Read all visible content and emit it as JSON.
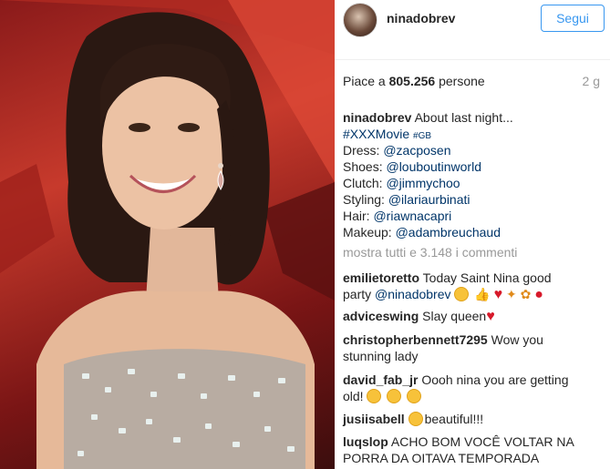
{
  "post": {
    "username": "ninadobrev",
    "follow_label": "Segui",
    "likes_prefix": "Piace a",
    "likes_count": "805.256",
    "likes_suffix": "persone",
    "time": "2 g",
    "caption": {
      "author": "ninadobrev",
      "text": "About last night...",
      "hashtag": "#XXXMovie",
      "hashtag2": "#GB",
      "lines": [
        {
          "label": "Dress:",
          "handle": "@zacposen"
        },
        {
          "label": "Shoes:",
          "handle": "@louboutinworld"
        },
        {
          "label": "Clutch:",
          "handle": "@jimmychoo"
        },
        {
          "label": "Styling:",
          "handle": "@ilariaurbinati"
        },
        {
          "label": "Hair:",
          "handle": "@riawnacapri"
        },
        {
          "label": "Makeup:",
          "handle": "@adambreuchaud"
        }
      ]
    },
    "view_all": "mostra tutti e 3.148 i commenti"
  },
  "comments": [
    {
      "user": "emilietoretto",
      "text1": "Today Saint Nina good",
      "text2_pre": "party ",
      "text2_mention": "@ninadobrev"
    },
    {
      "user": "adviceswing",
      "text1": "Slay queen"
    },
    {
      "user": "christopherbennett7295",
      "text1": "Wow you",
      "text2": "stunning lady"
    },
    {
      "user": "david_fab_jr",
      "text1": "Oooh nina you are getting",
      "text2": "old!"
    },
    {
      "user": "jusiisabell",
      "text1": "beautiful!!!"
    },
    {
      "user": "luqslop",
      "text1": "ACHO BOM VOCÊ VOLTAR NA",
      "text2": "PORRA DA OITAVA TEMPORADA"
    }
  ],
  "icons": {
    "avatar": "profile-avatar",
    "heart": "heart-emoji",
    "face": "smiley-emoji",
    "party": "party-emoji"
  },
  "colors": {
    "accent": "#3897f0",
    "link": "#003569",
    "muted": "#999999"
  }
}
